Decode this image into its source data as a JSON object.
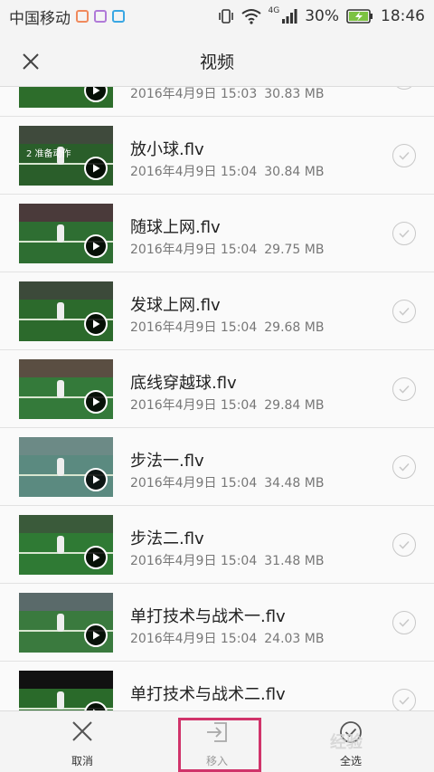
{
  "status_bar": {
    "carrier": "中国移动",
    "network": "4G",
    "battery": "30%",
    "time": "18:46",
    "badge_colors": [
      "#f08a5d",
      "#b07ad8",
      "#3aa7e3"
    ]
  },
  "app_bar": {
    "title": "视频",
    "close_icon": "close-icon"
  },
  "videos": [
    {
      "title": "",
      "date": "2016年4月9日 15:03",
      "size": "30.83 MB",
      "caption": ""
    },
    {
      "title": "放小球.flv",
      "date": "2016年4月9日 15:04",
      "size": "30.84 MB",
      "caption": "2 准备动作"
    },
    {
      "title": "随球上网.flv",
      "date": "2016年4月9日 15:04",
      "size": "29.75 MB",
      "caption": ""
    },
    {
      "title": "发球上网.flv",
      "date": "2016年4月9日 15:04",
      "size": "29.68 MB",
      "caption": ""
    },
    {
      "title": "底线穿越球.flv",
      "date": "2016年4月9日 15:04",
      "size": "29.84 MB",
      "caption": ""
    },
    {
      "title": "步法一.flv",
      "date": "2016年4月9日 15:04",
      "size": "34.48 MB",
      "caption": ""
    },
    {
      "title": "步法二.flv",
      "date": "2016年4月9日 15:04",
      "size": "31.48 MB",
      "caption": ""
    },
    {
      "title": "单打技术与战术一.flv",
      "date": "2016年4月9日 15:04",
      "size": "24.03 MB",
      "caption": ""
    },
    {
      "title": "单打技术与战术二.flv",
      "date": "",
      "size": "",
      "caption": ""
    }
  ],
  "bottom_bar": {
    "cancel_label": "取消",
    "move_label": "移入",
    "select_all_label": "全选"
  },
  "watermark": "经验",
  "colors": {
    "highlight": "#d0336a",
    "court": "#2e6b2a"
  }
}
